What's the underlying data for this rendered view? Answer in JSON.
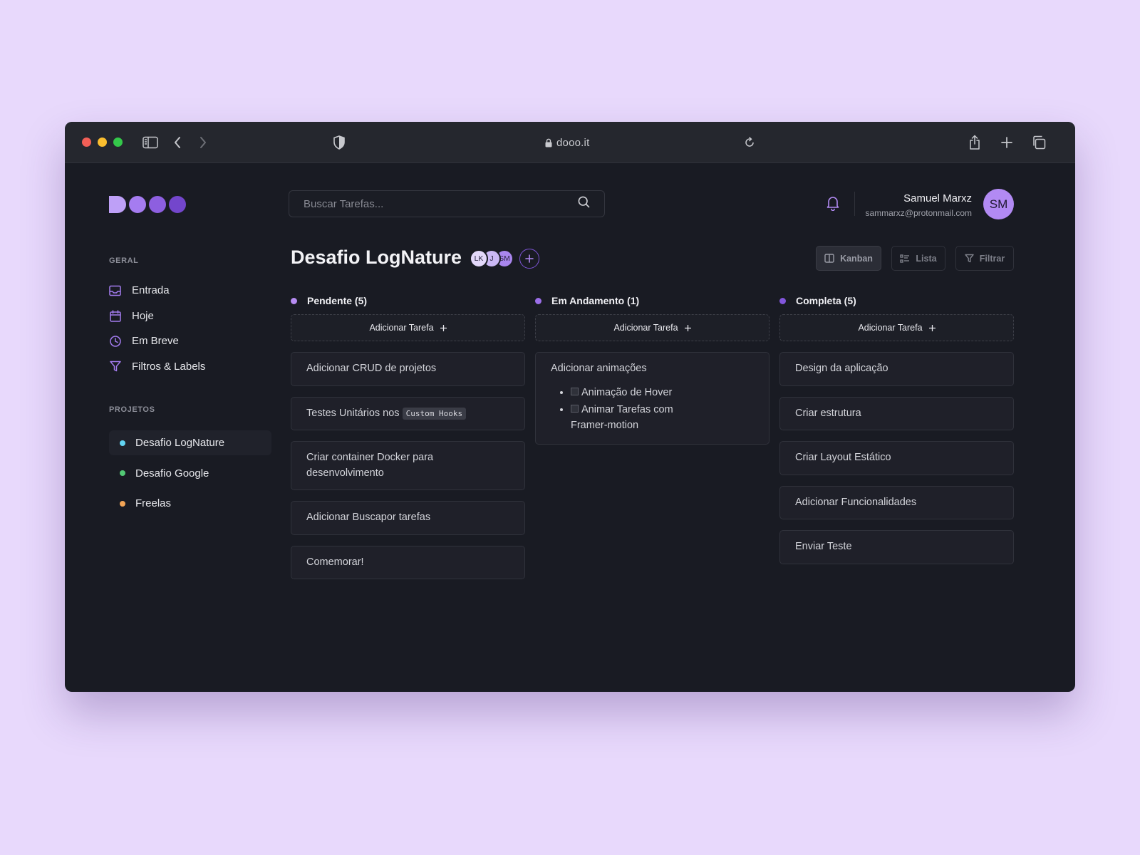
{
  "browser": {
    "url": "dooo.it"
  },
  "app": {
    "search": {
      "placeholder": "Buscar Tarefas..."
    },
    "user": {
      "name": "Samuel Marxz",
      "email": "sammarxz@protonmail.com",
      "initials": "SM"
    },
    "sidebar": {
      "geral_label": "GERAL",
      "nav": [
        {
          "label": "Entrada",
          "icon": "inbox-icon"
        },
        {
          "label": "Hoje",
          "icon": "calendar-icon"
        },
        {
          "label": "Em Breve",
          "icon": "clock-icon"
        },
        {
          "label": "Filtros & Labels",
          "icon": "filter-icon"
        }
      ],
      "projetos_label": "PROJETOS",
      "projects": [
        {
          "label": "Desafio LogNature",
          "color": "#62d4f2",
          "active": true
        },
        {
          "label": "Desafio Google",
          "color": "#52c975",
          "active": false
        },
        {
          "label": "Freelas",
          "color": "#f2a455",
          "active": false
        }
      ]
    },
    "board": {
      "title": "Desafio LogNature",
      "members": [
        "LK",
        "J",
        "SM"
      ],
      "views": {
        "kanban": "Kanban",
        "lista": "Lista",
        "filtrar": "Filtrar"
      },
      "add_task_label": "Adicionar Tarefa",
      "columns": [
        {
          "title": "Pendente (5)",
          "color": "#b68cf2",
          "cards": [
            {
              "text": "Adicionar CRUD de projetos"
            },
            {
              "text": "Testes Unitários nos ",
              "code": "Custom Hooks"
            },
            {
              "text": "Criar container Docker para desenvolvimento"
            },
            {
              "text": "Adicionar Buscapor tarefas"
            },
            {
              "text": "Comemorar!"
            }
          ]
        },
        {
          "title": "Em Andamento (1)",
          "color": "#9b6ee8",
          "cards": [
            {
              "text": "Adicionar animações",
              "checklist": [
                "Animação de Hover",
                "Animar Tarefas com Framer-motion"
              ]
            }
          ]
        },
        {
          "title": "Completa (5)",
          "color": "#8256dc",
          "cards": [
            {
              "text": "Design da aplicação"
            },
            {
              "text": "Criar estrutura"
            },
            {
              "text": "Criar Layout Estático"
            },
            {
              "text": "Adicionar Funcionalidades"
            },
            {
              "text": "Enviar Teste"
            }
          ]
        }
      ]
    }
  }
}
